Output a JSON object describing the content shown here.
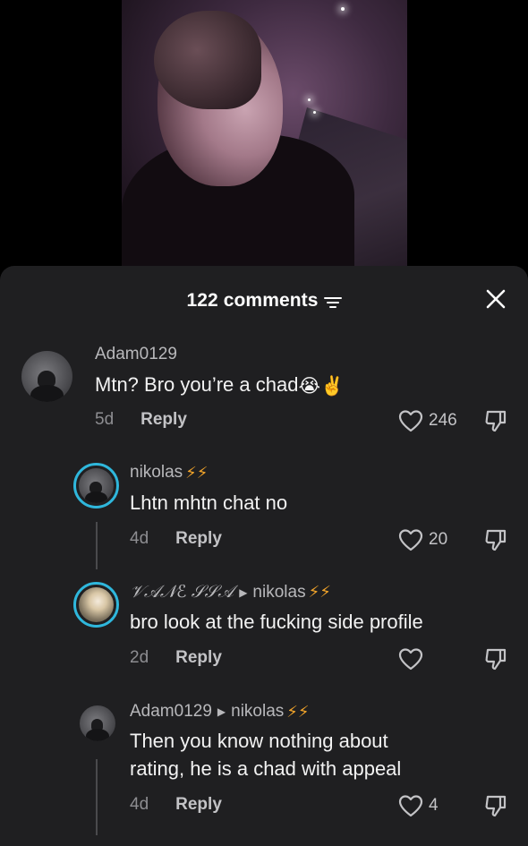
{
  "header": {
    "comment_count_label": "122 comments"
  },
  "comments": [
    {
      "username": "Adam0129",
      "text": "Mtn? Bro you’re a chad",
      "emojis": "😭✌️",
      "time": "5d",
      "reply_label": "Reply",
      "likes": "246"
    },
    {
      "username": "nikolas",
      "text": "Lhtn mhtn chat no",
      "time": "4d",
      "reply_label": "Reply",
      "likes": "20"
    },
    {
      "username": "𝒱𝒜𝒩ℰ 𝒮𝒮𝒜",
      "reply_to": "nikolas",
      "text": "bro look at the fucking side profile",
      "time": "2d",
      "reply_label": "Reply",
      "likes": ""
    },
    {
      "username": "Adam0129",
      "reply_to": "nikolas",
      "text_line1": "Then you know nothing about",
      "text_line2": "rating, he is a chad with appeal",
      "time": "4d",
      "reply_label": "Reply",
      "likes": "4"
    }
  ],
  "icons": {
    "filter": "filter-lines-icon",
    "close": "close-icon",
    "heart": "heart-outline-icon",
    "dislike": "thumbs-down-icon",
    "bolt": "lightning-bolt-icon"
  },
  "colors": {
    "sheet_bg": "#1f1f21",
    "story_ring": "#2fb7dc",
    "bolt": "#f2a42a"
  }
}
